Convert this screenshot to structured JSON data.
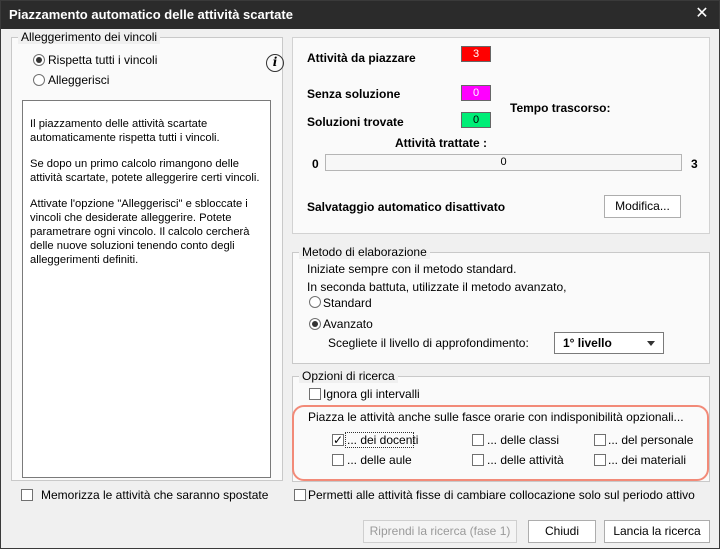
{
  "window": {
    "title": "Piazzamento automatico delle attività scartate"
  },
  "vincoli": {
    "legend": "Alleggerimento dei vincoli",
    "option_all": "Rispetta tutti i vincoli",
    "option_lighten": "Alleggerisci",
    "paragraphs": [
      "Il piazzamento delle attività scartate automaticamente rispetta tutti i vincoli.",
      "Se dopo un primo calcolo rimangono delle attività scartate, potete alleggerire certi vincoli.",
      "Attivate l'opzione \"Alleggerisci\" e sbloccate i vincoli che desiderate alleggerire. Potete parametrare ogni vincolo. Il calcolo cercherà delle nuove soluzioni tenendo conto degli alleggerimenti definiti."
    ]
  },
  "status": {
    "to_place_label": "Attività da piazzare",
    "to_place_value": "3",
    "no_solution_label": "Senza soluzione",
    "no_solution_value": "0",
    "found_label": "Soluzioni trovate",
    "found_value": "0",
    "elapsed_label": "Tempo trascorso:",
    "processed_label": "Attività trattate   :",
    "progress_min": "0",
    "progress_value": "0",
    "progress_max": "3",
    "autosave_label": "Salvataggio automatico disattivato",
    "modify_button": "Modifica..."
  },
  "metodo": {
    "legend": "Metodo di elaborazione",
    "line1": "Iniziate sempre con il metodo standard.",
    "line2": "In seconda battuta, utilizzate il metodo avanzato,",
    "standard": "Standard",
    "advanced": "Avanzato",
    "level_label": "Scegliete il livello di approfondimento:",
    "level_value": "1° livello"
  },
  "ricerca": {
    "legend": "Opzioni di ricerca",
    "ignore_intervals": "Ignora gli intervalli",
    "place_label": "Piazza le attività anche sulle fasce orarie con indisponibilità opzionali...",
    "docenti": "... dei docenti",
    "classi": "... delle classi",
    "personale": "... del personale",
    "aule": "... delle aule",
    "attivita": "... delle attività",
    "materiali": "... dei materiali"
  },
  "footer": {
    "memorize": "Memorizza le attività che saranno spostate",
    "allow_fixed": "Permetti alle attività fisse di cambiare collocazione solo sul periodo attivo",
    "resume_button": "Riprendi la ricerca (fase 1)",
    "close_button": "Chiudi",
    "launch_button": "Lancia la ricerca"
  },
  "colors": {
    "to_place": "#ff0000",
    "no_solution": "#ff00ff",
    "found": "#00ee77",
    "highlight": "#f28a78"
  }
}
